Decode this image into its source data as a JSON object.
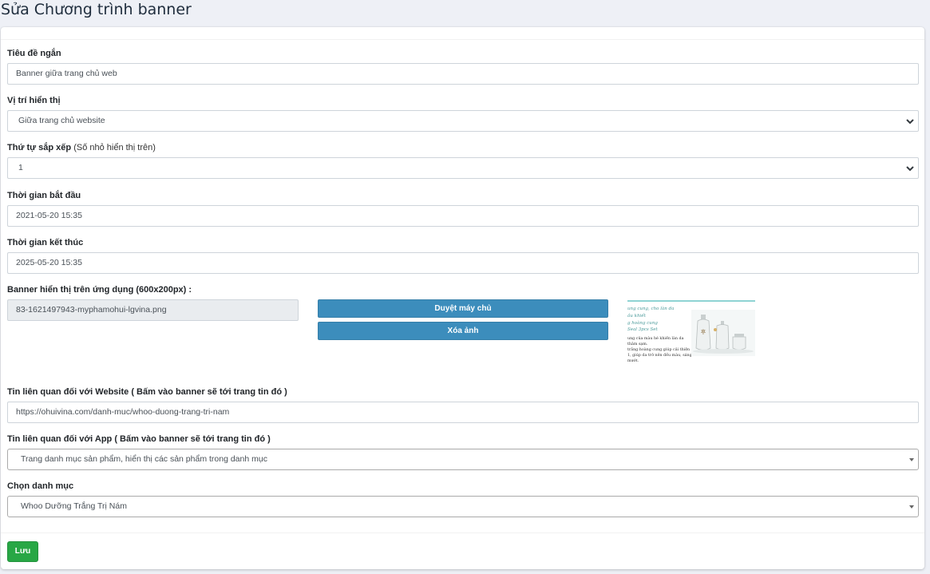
{
  "page": {
    "title": "Sửa Chương trình banner"
  },
  "form": {
    "short_title": {
      "label": "Tiêu đề ngắn",
      "value": "Banner giữa trang chủ web"
    },
    "position": {
      "label": "Vị trí hiển thị",
      "value": "Giữa trang chủ website"
    },
    "order": {
      "label": "Thứ tự sắp xếp",
      "hint": "(Số nhỏ hiển thị trên)",
      "value": "1"
    },
    "start_time": {
      "label": "Thời gian bắt đầu",
      "value": "2021-05-20 15:35"
    },
    "end_time": {
      "label": "Thời gian kết thúc",
      "value": "2025-05-20 15:35"
    },
    "banner": {
      "label": "Banner hiển thị trên ứng dụng (600x200px) :",
      "filename": "83-1621497943-myphamohui-lgvina.png",
      "browse_label": "Duyệt máy chủ",
      "delete_label": "Xóa ảnh",
      "thumb_text": {
        "line1": "ung cung, cho làn da",
        "line2": "ầu khiết",
        "line3": "g hoàng cung",
        "line4": "Seal 3pcs Set",
        "body1": "ung của màu hé khiến làn da",
        "body2": "thâm sạm.",
        "body3": "trắng hoàng cung giúp cải thiện",
        "body4": "1, giúp da trở nên đều màu, sáng",
        "body5": "mướt."
      }
    },
    "website_link": {
      "label": "Tin liên quan đối với Website ( Bấm vào banner sẽ tới trang tin đó )",
      "value": "https://ohuivina.com/danh-muc/whoo-duong-trang-tri-nam"
    },
    "app_link": {
      "label": "Tin liên quan đối với App ( Bấm vào banner sẽ tới trang tin đó )",
      "value": "Trang danh mục sản phẩm, hiển thị các sản phẩm trong danh mục"
    },
    "category": {
      "label": "Chọn danh mục",
      "value": "Whoo Dưỡng Trắng Trị Nám"
    },
    "save_label": "Lưu"
  },
  "icons": {
    "select_arrow": "chevron-down-icon",
    "select2_arrow": "caret-down-icon"
  },
  "colors": {
    "primary": "#3c8dbc",
    "success": "#28a745",
    "background": "#eef0f6"
  }
}
